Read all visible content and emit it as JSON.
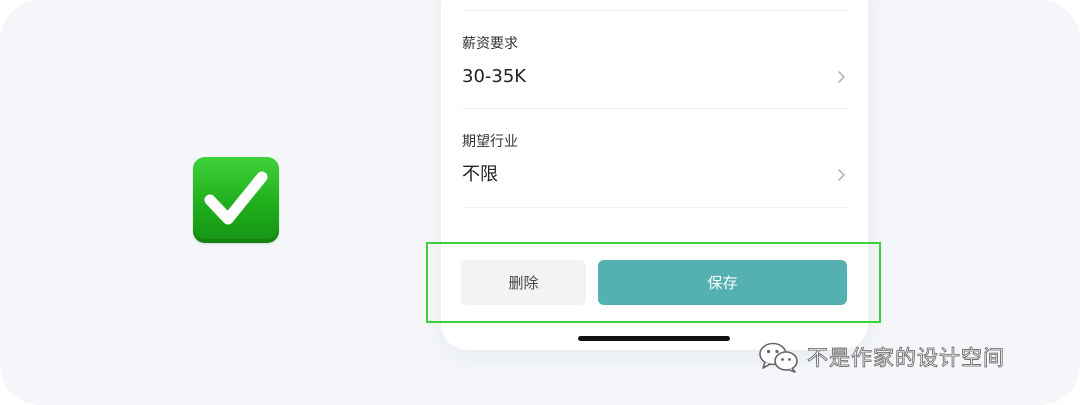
{
  "form": {
    "rows": [
      {
        "label": "薪资要求",
        "value": "30-35K"
      },
      {
        "label": "期望行业",
        "value": "不限"
      }
    ]
  },
  "actions": {
    "delete_label": "删除",
    "save_label": "保存"
  },
  "watermark": {
    "text": "不是作家的设计空间",
    "icon": "wechat-icon"
  },
  "colors": {
    "accent": "#55b0b1",
    "highlight": "#3ad23a",
    "check_badge": "#1fae1c",
    "background": "#f4f6f9"
  },
  "badge": {
    "icon": "check-mark-icon"
  }
}
